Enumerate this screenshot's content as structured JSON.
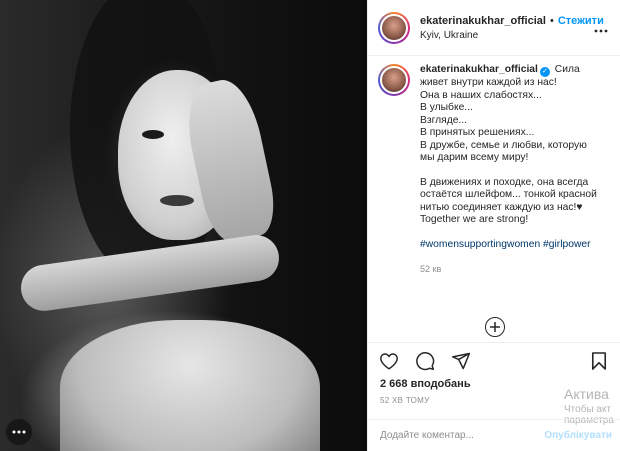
{
  "post": {
    "username": "ekaterinakukhar_official",
    "separator": "•",
    "follow_label": "Стежити",
    "location": "Kyiv, Ukraine",
    "more_icon": "more-icon"
  },
  "caption": {
    "username": "ekaterinakukhar_official",
    "first_line_rest": "Сила",
    "lines": [
      "живет внутри каждой из нас!",
      "Она в наших слабостях...",
      "В улыбке...",
      "Взгляде...",
      "В принятых решениях...",
      "В дружбе, семье и любви, которую",
      "мы дарим всему миру!"
    ],
    "lines2": [
      "В движениях и походке, она всегда",
      "остаётся шлейфом... тонкой красной",
      "нитью соединяет каждую из нас!♥",
      "Together we are strong!"
    ],
    "tags": "#womensupportingwomen #girlpower",
    "time": "52 кв"
  },
  "actions": {
    "like_icon": "heart-icon",
    "comment_icon": "comment-icon",
    "share_icon": "share-icon",
    "save_icon": "bookmark-icon"
  },
  "likes": "2 668 вподобань",
  "posted": "52 ХВ ТОМУ",
  "windows_watermark": {
    "line1": "Актива",
    "line2": "Чтобы акт",
    "line3": "параметра"
  },
  "comment": {
    "placeholder": "Додайте коментар...",
    "publish_label": "Опублікувати"
  }
}
